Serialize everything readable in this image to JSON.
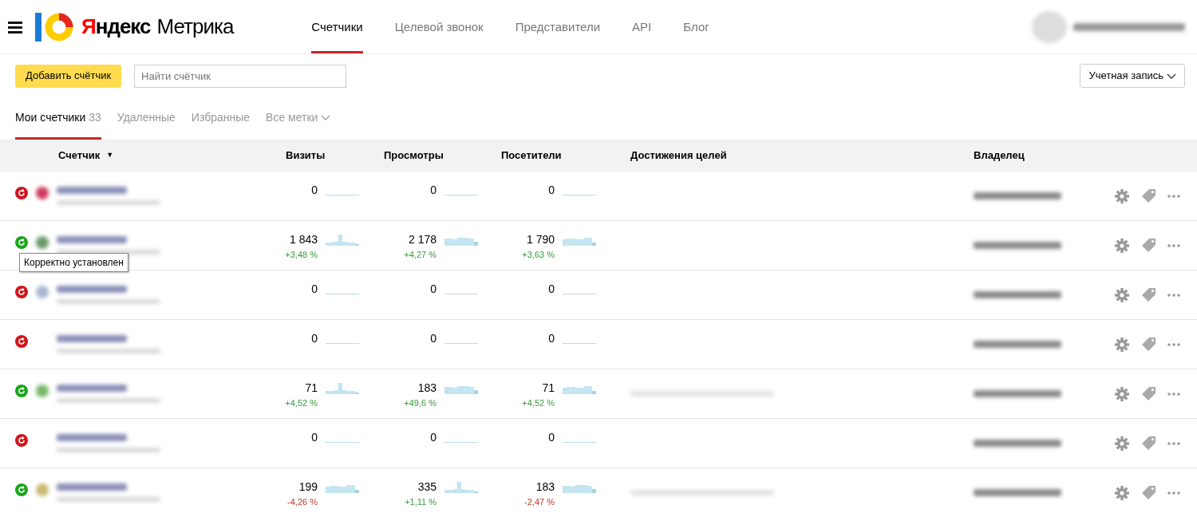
{
  "header": {
    "logo": {
      "brand": "Яндекс",
      "product": "Метрика"
    },
    "nav": [
      {
        "label": "Счетчики",
        "selected": true
      },
      {
        "label": "Целевой звонок",
        "selected": false
      },
      {
        "label": "Представители",
        "selected": false
      },
      {
        "label": "API",
        "selected": false
      },
      {
        "label": "Блог",
        "selected": false
      }
    ]
  },
  "toolbar": {
    "add_button": "Добавить счётчик",
    "search": {
      "placeholder": "Найти счётчик"
    },
    "account_button": "Учетная запись"
  },
  "tabs": [
    {
      "label": "Мои счетчики",
      "count": "33",
      "selected": true
    },
    {
      "label": "Удаленные",
      "selected": false
    },
    {
      "label": "Избранные",
      "selected": false
    },
    {
      "label": "Все метки",
      "dropdown": true,
      "selected": false
    }
  ],
  "table": {
    "columns": [
      {
        "label": "Счетчик",
        "sort_indicator": "▼"
      },
      {
        "label": "Визиты"
      },
      {
        "label": "Просмотры"
      },
      {
        "label": "Посетители"
      },
      {
        "label": "Достижения целей"
      },
      {
        "label": "Владелец"
      }
    ],
    "rows": [
      {
        "installed": false,
        "color": "#d23a60",
        "visits": {
          "value": "0"
        },
        "views": {
          "value": "0"
        },
        "visitors": {
          "value": "0"
        },
        "has_goals": false
      },
      {
        "installed": true,
        "color": "#6a9a6a",
        "visits": {
          "value": "1 843",
          "change": "+3,48 %",
          "color": "#3a9a3a"
        },
        "views": {
          "value": "2 178",
          "change": "+4,27 %",
          "color": "#3a9a3a"
        },
        "visitors": {
          "value": "1 790",
          "change": "+3,63 %",
          "color": "#3a9a3a"
        },
        "has_goals": false
      },
      {
        "installed": false,
        "color": "#a8b8d0",
        "visits": {
          "value": "0"
        },
        "views": {
          "value": "0"
        },
        "visitors": {
          "value": "0"
        },
        "has_goals": false
      },
      {
        "installed": false,
        "visits": {
          "value": "0"
        },
        "views": {
          "value": "0"
        },
        "visitors": {
          "value": "0"
        },
        "has_goals": false
      },
      {
        "installed": true,
        "color": "#7ab86a",
        "visits": {
          "value": "71",
          "change": "+4,52 %",
          "color": "#3a9a3a"
        },
        "views": {
          "value": "183",
          "change": "+49,6 %",
          "color": "#3a9a3a"
        },
        "visitors": {
          "value": "71",
          "change": "+4,52 %",
          "color": "#3a9a3a"
        },
        "has_goals": true
      },
      {
        "installed": false,
        "visits": {
          "value": "0"
        },
        "views": {
          "value": "0"
        },
        "visitors": {
          "value": "0"
        },
        "has_goals": false
      },
      {
        "installed": true,
        "color": "#c8b870",
        "visits": {
          "value": "199",
          "change": "-4,26 %",
          "color": "#c0392b"
        },
        "views": {
          "value": "335",
          "change": "+1,11 %",
          "color": "#3a9a3a"
        },
        "visitors": {
          "value": "183",
          "change": "-2,47 %",
          "color": "#c0392b"
        },
        "has_goals": true
      }
    ]
  },
  "tooltip": "Корректно установлен"
}
